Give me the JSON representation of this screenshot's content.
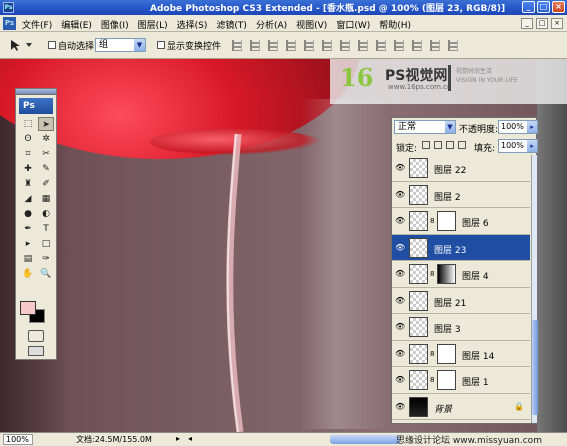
{
  "window": {
    "title": "Adobe Photoshop CS3 Extended - [香水瓶.psd @ 100% (图层 23, RGB/8)]",
    "app_icon": "Ps",
    "controls": [
      "_",
      "□",
      "×"
    ]
  },
  "menubar": {
    "logo": "Ps",
    "items": [
      "文件(F)",
      "编辑(E)",
      "图像(I)",
      "图层(L)",
      "选择(S)",
      "滤镜(T)",
      "分析(A)",
      "视图(V)",
      "窗口(W)",
      "帮助(H)"
    ],
    "doc_controls": [
      "_",
      "□",
      "×"
    ]
  },
  "options": {
    "auto_select_label": "自动选择:",
    "auto_select_value": "组",
    "show_transform_label": "显示变换控件"
  },
  "watermark": {
    "logo": "16",
    "title": "PS视觉网",
    "url": "www.16ps.com.cn",
    "tagline_1": "视觉时尚生活",
    "tagline_2": "VISION IN YOUR LIFE"
  },
  "tools": {
    "badge": "Ps",
    "icons": [
      "marquee-icon",
      "move-icon",
      "lasso-icon",
      "magic-wand-icon",
      "crop-icon",
      "slice-icon",
      "healing-icon",
      "brush-icon",
      "stamp-icon",
      "history-brush-icon",
      "eraser-icon",
      "gradient-icon",
      "blur-icon",
      "dodge-icon",
      "pen-icon",
      "type-icon",
      "path-select-icon",
      "shape-icon",
      "notes-icon",
      "eyedropper-icon",
      "hand-icon",
      "zoom-icon"
    ],
    "glyphs": [
      "⬚",
      "➤",
      "ʘ",
      "✲",
      "⌗",
      "✂",
      "✚",
      "✎",
      "♜",
      "✐",
      "◢",
      "▦",
      "●",
      "◐",
      "✒",
      "T",
      "▸",
      "□",
      "▤",
      "✑",
      "✋",
      "🔍"
    ],
    "foreground_color": "#f6c8c8",
    "background_color": "#000000"
  },
  "layers": {
    "blend_mode": "正常",
    "opacity_label": "不透明度:",
    "opacity_value": "100%",
    "lock_label": "锁定:",
    "fill_label": "填充:",
    "fill_value": "100%",
    "rows": [
      {
        "name": "图层 22",
        "thumb": "checker",
        "mask": "",
        "selected": false
      },
      {
        "name": "图层 2",
        "thumb": "checker",
        "mask": "",
        "selected": false
      },
      {
        "name": "图层 6",
        "thumb": "checker",
        "mask": "white",
        "selected": false
      },
      {
        "name": "图层 23",
        "thumb": "checker",
        "mask": "",
        "selected": true
      },
      {
        "name": "图层 4",
        "thumb": "checker",
        "mask": "gradient",
        "selected": false
      },
      {
        "name": "图层 21",
        "thumb": "checker",
        "mask": "",
        "selected": false
      },
      {
        "name": "图层 3",
        "thumb": "checker",
        "mask": "",
        "selected": false
      },
      {
        "name": "图层 14",
        "thumb": "checker",
        "mask": "white",
        "selected": false
      },
      {
        "name": "图层 1",
        "thumb": "checker",
        "mask": "white",
        "selected": false
      },
      {
        "name": "背景",
        "thumb": "black",
        "mask": "",
        "selected": false
      }
    ]
  },
  "status": {
    "zoom": "100%",
    "doc_info": "文档:24.5M/155.0M",
    "credit": "思缘设计论坛  www.missyuan.com"
  }
}
